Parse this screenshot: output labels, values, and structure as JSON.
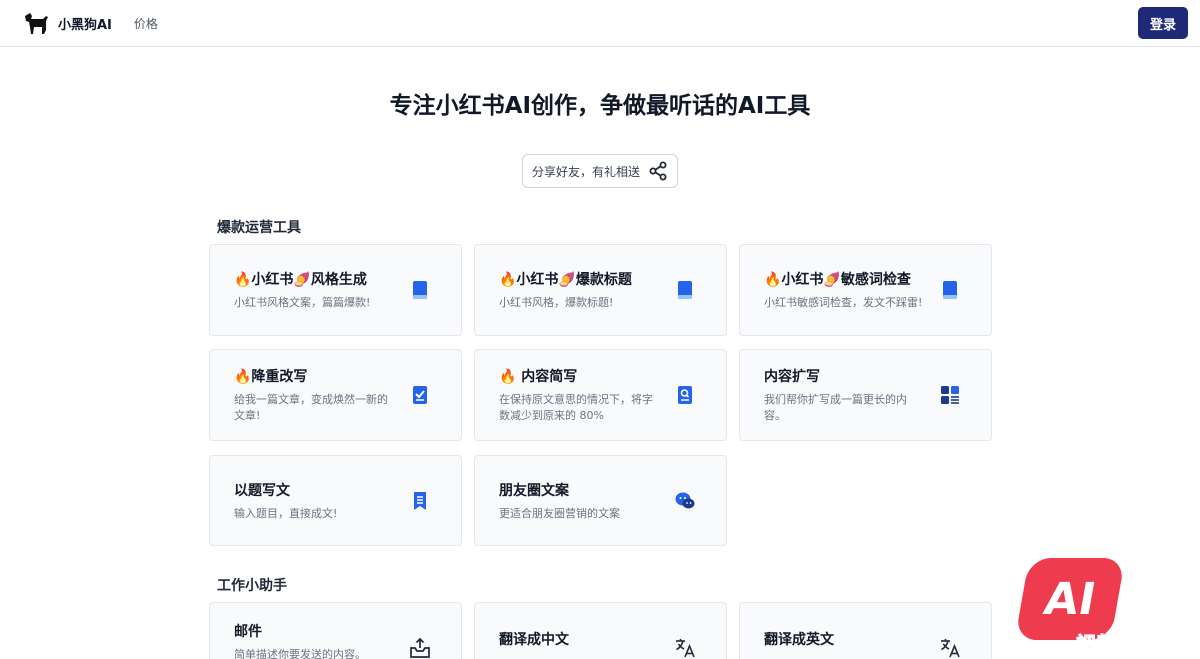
{
  "nav": {
    "brand": "小黑狗AI",
    "pricing": "价格",
    "login": "登录"
  },
  "hero": {
    "title": "专注小红书AI创作，争做最听话的AI工具",
    "share": "分享好友，有礼相送"
  },
  "sections": [
    {
      "title": "爆款运营工具",
      "cards": [
        {
          "title": "🔥小红书🍠风格生成",
          "desc": "小红书风格文案，篇篇爆款!",
          "icon": "book-icon"
        },
        {
          "title": "🔥小红书🍠爆款标题",
          "desc": "小红书风格，爆款标题!",
          "icon": "book-icon"
        },
        {
          "title": "🔥小红书🍠敏感词检查",
          "desc": "小红书敏感词检查，发文不踩雷!",
          "icon": "book-icon"
        },
        {
          "title": "🔥降重改写",
          "desc": "给我一篇文章，变成焕然一新的文章!",
          "icon": "clipboard-check-icon"
        },
        {
          "title": "🔥 内容简写",
          "desc": "在保持原文意思的情况下，将字数减少到原来的 80%",
          "icon": "document-search-icon"
        },
        {
          "title": "内容扩写",
          "desc": "我们帮你扩写成一篇更长的内容。",
          "icon": "grid-list-icon"
        },
        {
          "title": "以题写文",
          "desc": "输入题目，直接成文!",
          "icon": "bookmark-doc-icon"
        },
        {
          "title": "朋友圈文案",
          "desc": "更适合朋友圈营销的文案",
          "icon": "chat-bubbles-icon"
        }
      ]
    },
    {
      "title": "工作小助手",
      "cards": [
        {
          "title": "邮件",
          "desc": "简单描述你要发送的内容。",
          "icon": "inbox-upload-icon"
        },
        {
          "title": "翻译成中文",
          "desc": "",
          "icon": "translate-icon"
        },
        {
          "title": "翻译成英文",
          "desc": "",
          "icon": "translate-icon"
        }
      ]
    }
  ],
  "watermark": {
    "logo": "AI",
    "text": "视频贴吧"
  },
  "colors": {
    "primary": "#1e2a78",
    "icon_blue": "#2563eb",
    "watermark": "#ee3b4e"
  }
}
